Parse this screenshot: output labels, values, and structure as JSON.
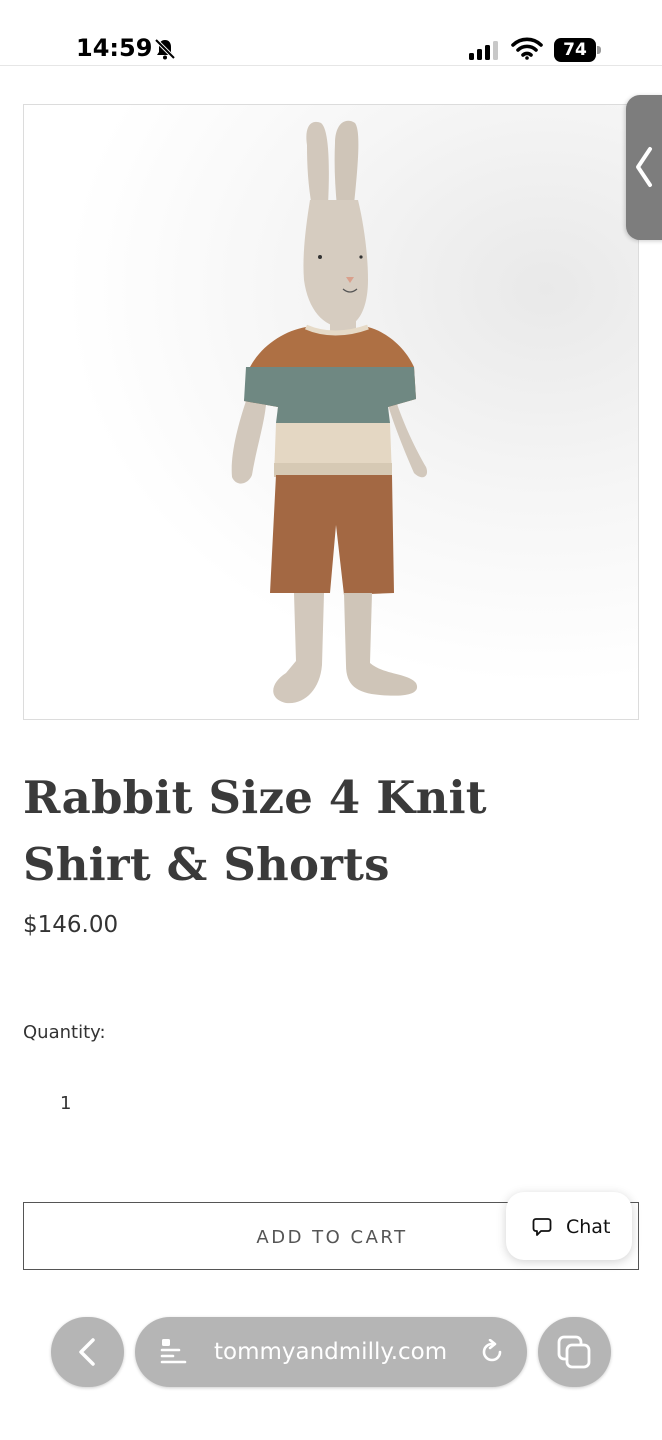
{
  "status_bar": {
    "time": "14:59",
    "battery": "74",
    "icons": [
      "bell-slash-icon",
      "cellular-signal-icon",
      "wifi-icon",
      "battery-icon"
    ]
  },
  "product": {
    "image_icon": "rabbit-doll-image",
    "title": "Rabbit Size 4 Knit Shirt & Shorts",
    "price": "$146.00",
    "quantity_label": "Quantity:",
    "quantity_value": "1",
    "add_to_cart_label": "ADD TO CART"
  },
  "chat": {
    "label": "Chat",
    "icon": "chat-bubble-icon"
  },
  "browser": {
    "url": "tommyandmilly.com",
    "icons": [
      "back-icon",
      "page-settings-icon",
      "reload-icon",
      "tabs-icon"
    ]
  },
  "colors": {
    "text": "#3a3a3a",
    "button_border": "#555555",
    "browser_pill": "#b5b5b5",
    "side_tab": "#7d7d7d"
  }
}
